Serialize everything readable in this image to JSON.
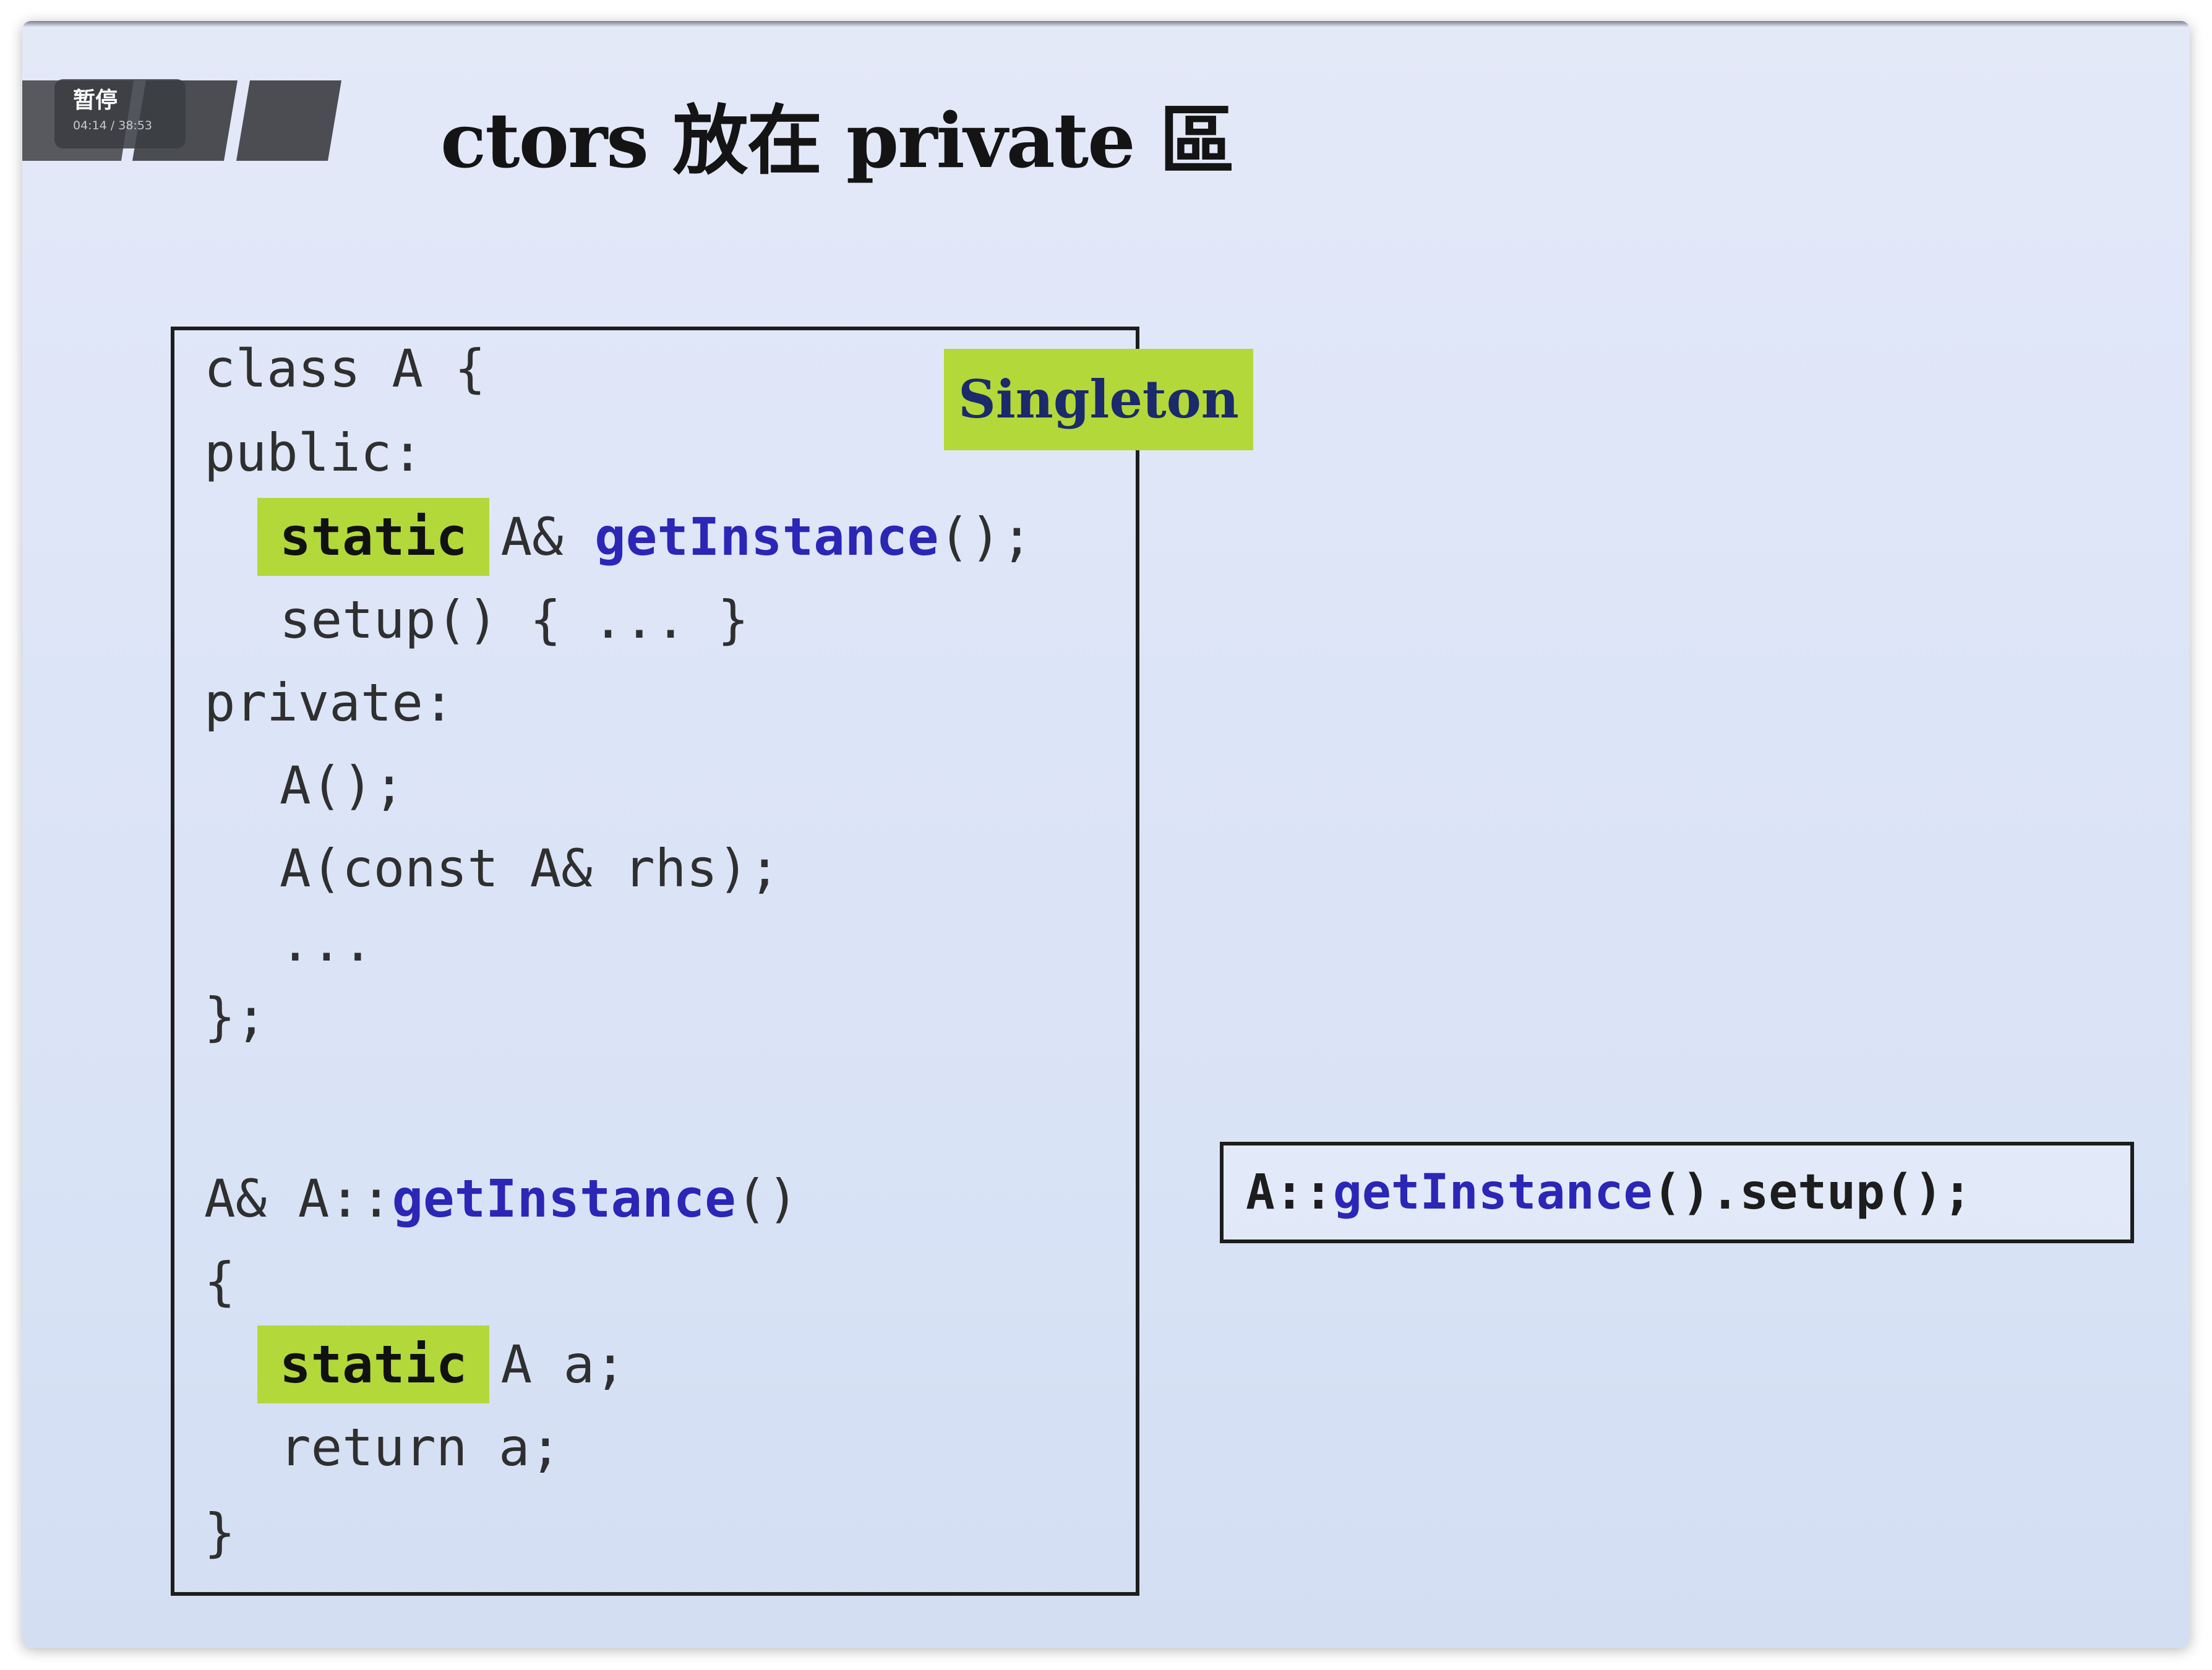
{
  "player": {
    "status_label": "暂停",
    "time": "04:14 / 38:53"
  },
  "slide": {
    "title": "ctors 放在 private 區",
    "singleton_tag": "Singleton",
    "code": {
      "class_decl": "class A {",
      "public_label": "public:",
      "static_kw_1": "static",
      "ret_type_1": "A&",
      "get_instance_1": "getInstance",
      "call_suffix_1": "();",
      "setup_line": "setup() { ... }",
      "private_label": "private:",
      "ctor_default": "A();",
      "ctor_copy": "A(const A& rhs);",
      "ellipsis": "...",
      "class_end": "};",
      "def_prefix": "A& A::",
      "get_instance_2": "getInstance",
      "def_suffix": "()",
      "brace_open": "{",
      "static_kw_2": "static",
      "static_var_rest": "A a;",
      "return_line": "return a;",
      "brace_close": "}"
    },
    "call_example": {
      "prefix": "A::",
      "method": "getInstance",
      "suffix": "().setup();"
    }
  },
  "colors": {
    "highlight_green": "#b3d83a",
    "function_blue": "#2b26b6",
    "slide_background": "#dde5f7"
  }
}
